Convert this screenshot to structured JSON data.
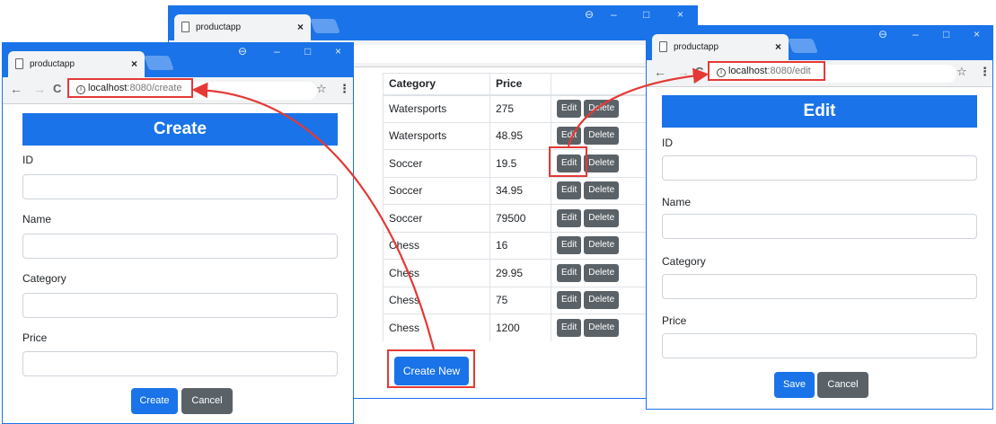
{
  "browser": {
    "tab_title": "productapp",
    "tab_close": "×",
    "minimize": "–",
    "maximize": "□",
    "close": "×",
    "profile_glyph": "⊖",
    "back": "←",
    "forward": "→",
    "reload": "C",
    "info_glyph": "i",
    "star": "☆",
    "menu": "⋮"
  },
  "create_window": {
    "url_host": "localhost",
    "url_path": ":8080/create",
    "heading": "Create",
    "fields": [
      {
        "label": "ID",
        "value": ""
      },
      {
        "label": "Name",
        "value": ""
      },
      {
        "label": "Category",
        "value": ""
      },
      {
        "label": "Price",
        "value": ""
      }
    ],
    "buttons": {
      "submit": "Create",
      "cancel": "Cancel"
    }
  },
  "list_window": {
    "columns": [
      "Category",
      "Price",
      ""
    ],
    "rows": [
      {
        "category": "Watersports",
        "price": "275"
      },
      {
        "category": "Watersports",
        "price": "48.95"
      },
      {
        "category": "Soccer",
        "price": "19.5"
      },
      {
        "category": "Soccer",
        "price": "34.95"
      },
      {
        "category": "Soccer",
        "price": "79500"
      },
      {
        "category": "Chess",
        "price": "16"
      },
      {
        "category": "Chess",
        "price": "29.95"
      },
      {
        "category": "Chess",
        "price": "75"
      },
      {
        "category": "Chess",
        "price": "1200"
      }
    ],
    "row_buttons": {
      "edit": "Edit",
      "delete": "Delete"
    },
    "create_new": "Create New"
  },
  "edit_window": {
    "url_host": "localhost",
    "url_path": ":8080/edit",
    "heading": "Edit",
    "fields": [
      {
        "label": "ID",
        "value": ""
      },
      {
        "label": "Name",
        "value": ""
      },
      {
        "label": "Category",
        "value": ""
      },
      {
        "label": "Price",
        "value": ""
      }
    ],
    "buttons": {
      "submit": "Save",
      "cancel": "Cancel"
    }
  },
  "colors": {
    "chrome_blue": "#1a73e8",
    "primary_button": "#1a73e8",
    "secondary_button": "#5a6268",
    "callout_red": "#e53935"
  }
}
